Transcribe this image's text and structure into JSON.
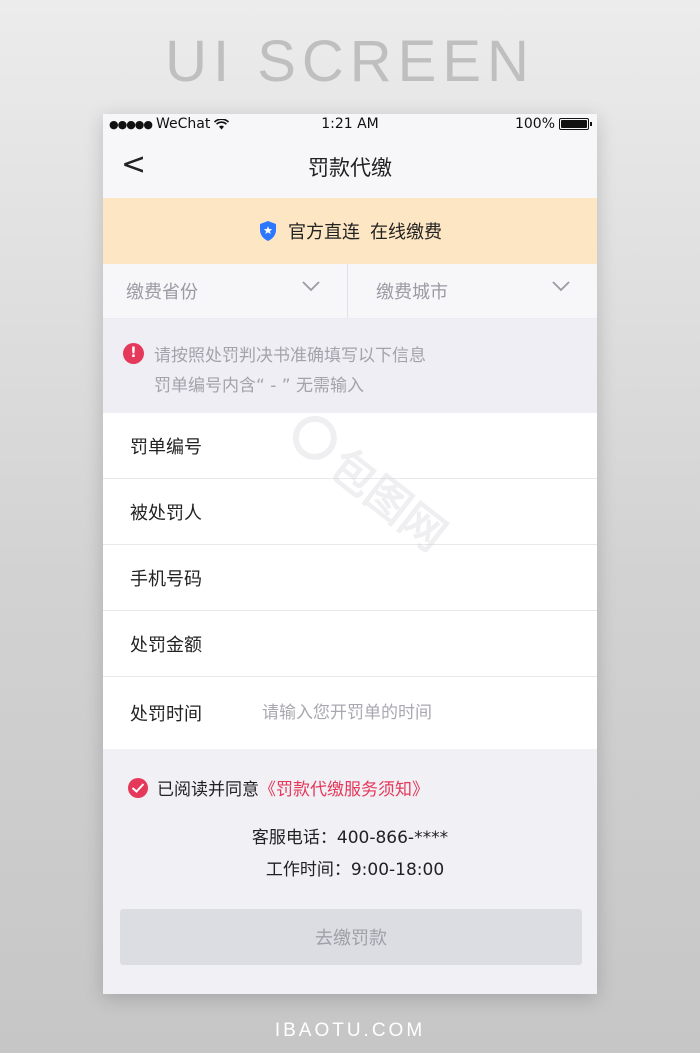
{
  "page": {
    "heading": "UI SCREEN",
    "footer_brand": "IBAOTU.COM",
    "watermark_text": "包图网"
  },
  "status_bar": {
    "signal": "●●●●●",
    "carrier": "WeChat",
    "time": "1:21 AM",
    "battery": "100%"
  },
  "nav": {
    "back_glyph": "<",
    "title": "罚款代缴"
  },
  "banner": {
    "part1": "官方直连",
    "part2": "在线缴费",
    "accent": "#2b78ff"
  },
  "selectors": {
    "province": "缴费省份",
    "city": "缴费城市"
  },
  "notice": {
    "icon_glyph": "!",
    "line1": "请按照处罚判决书准确填写以下信息",
    "line2": "罚单编号内含“ - ” 无需输入"
  },
  "form": {
    "fields": [
      {
        "label": "罚单编号",
        "value": "",
        "placeholder": ""
      },
      {
        "label": "被处罚人",
        "value": "",
        "placeholder": ""
      },
      {
        "label": "手机号码",
        "value": "",
        "placeholder": ""
      },
      {
        "label": "处罚金额",
        "value": "",
        "placeholder": ""
      },
      {
        "label": "处罚时间",
        "value": "",
        "placeholder": "请输入您开罚单的时间"
      }
    ]
  },
  "agreement": {
    "prefix": "已阅读并同意",
    "link": "《罚款代缴服务须知》"
  },
  "service": {
    "phone": "客服电话：400-866-****",
    "hours": "工作时间：9:00-18:00"
  },
  "submit": {
    "label": "去缴罚款"
  },
  "colors": {
    "accent_red": "#e5395b",
    "banner_bg": "#fde6c4"
  }
}
